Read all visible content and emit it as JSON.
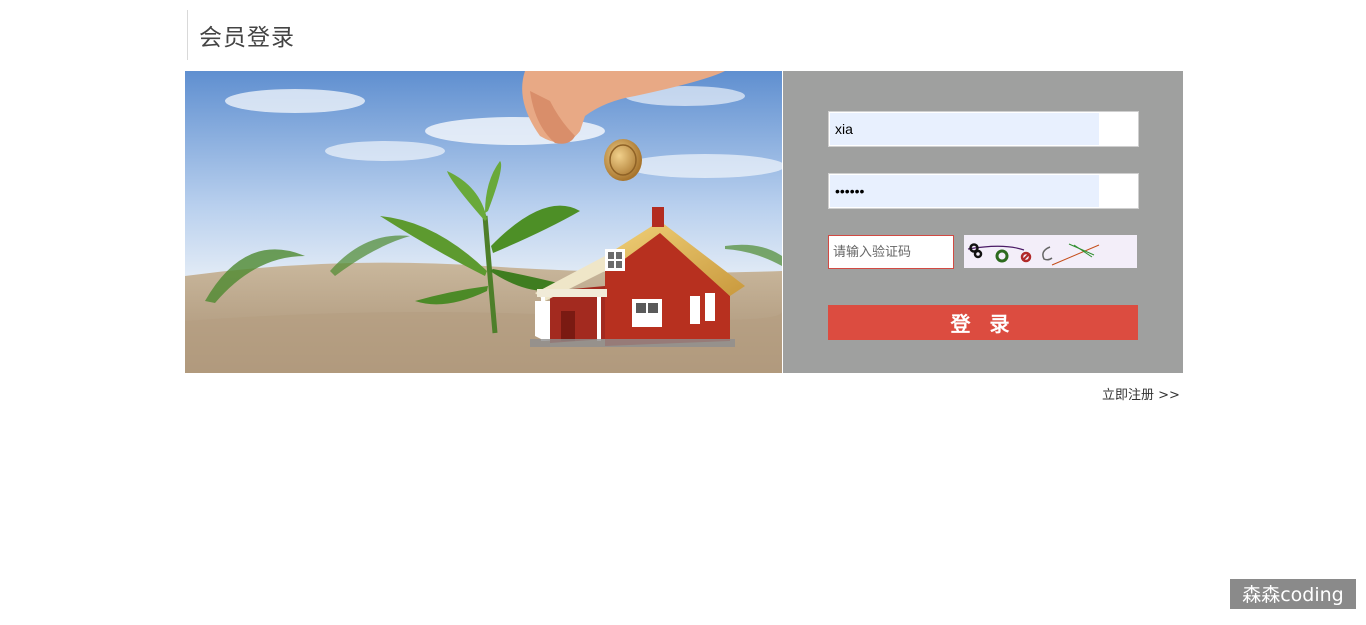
{
  "header": {
    "title": "会员登录"
  },
  "login_form": {
    "username_value": "xia",
    "password_value": "••••••",
    "captcha_placeholder": "请输入验证码",
    "login_button_label": "登 录"
  },
  "footer": {
    "register_link": "立即注册 >>"
  },
  "watermark": {
    "text": "森森coding"
  },
  "colors": {
    "panel_background": "#9fa09f",
    "login_button": "#dc4c40",
    "autofill_field": "#e8f0fe",
    "captcha_background": "#f3eef9"
  }
}
